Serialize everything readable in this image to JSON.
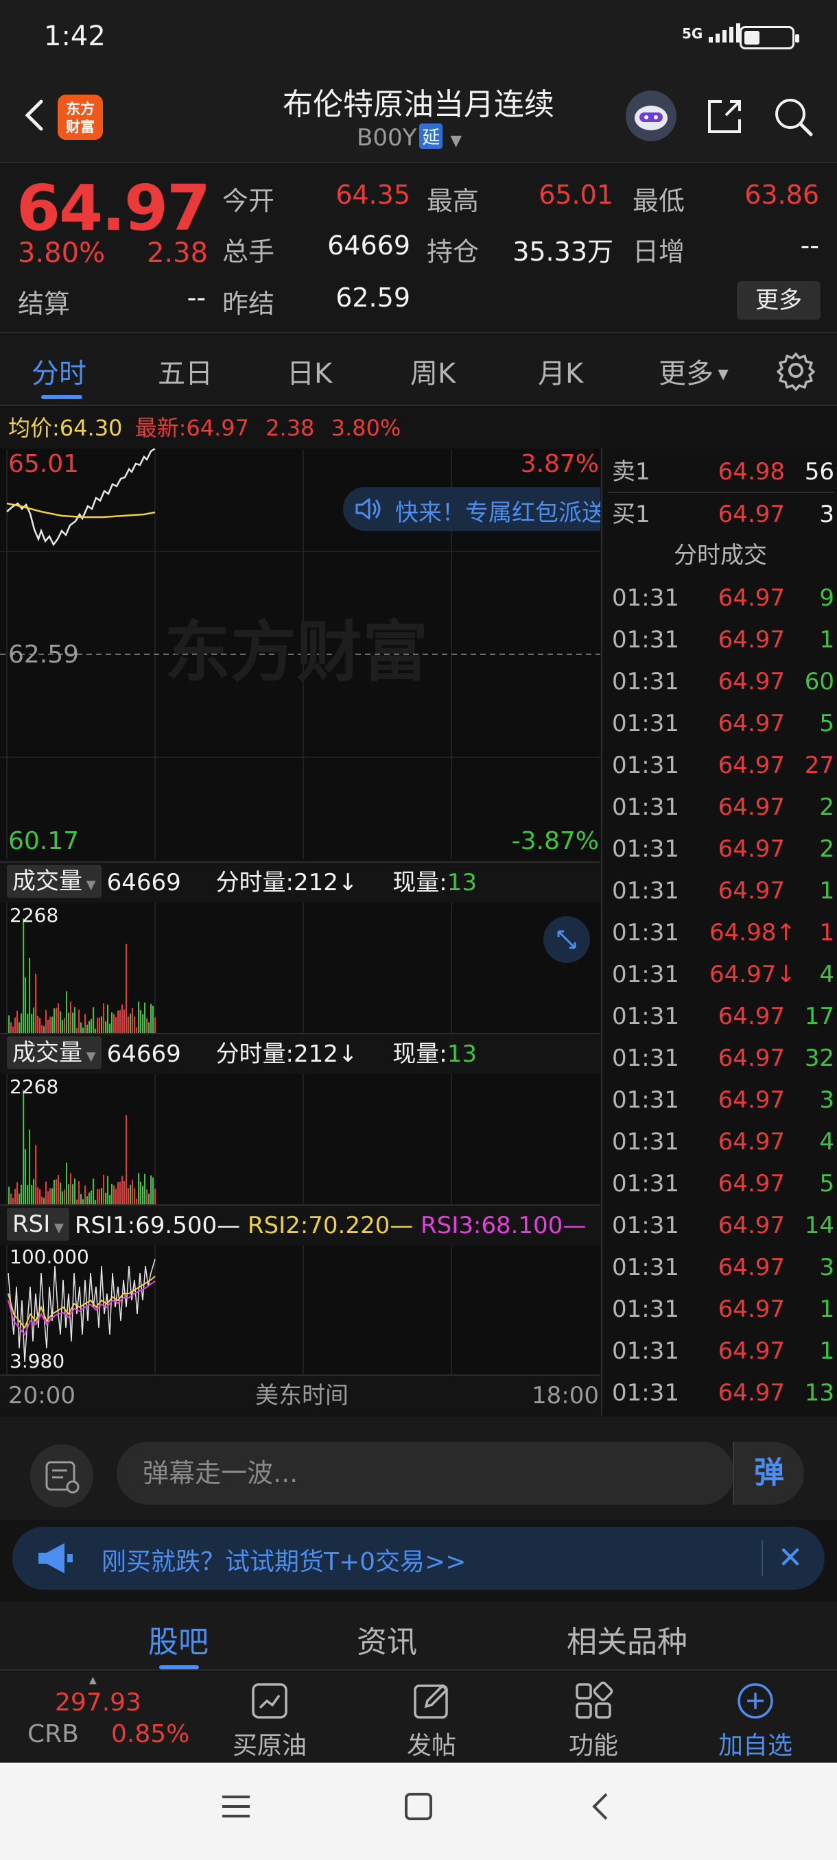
{
  "status": {
    "time": "1:42",
    "network": "5G"
  },
  "header": {
    "title": "布伦特原油当月连续",
    "code": "B00Y",
    "delay_badge": "延",
    "logo_line1": "东方",
    "logo_line2": "财富"
  },
  "quote": {
    "price": "64.97",
    "change_pct": "3.80%",
    "change": "2.38",
    "open_label": "今开",
    "open": "64.35",
    "high_label": "最高",
    "high": "65.01",
    "low_label": "最低",
    "low": "63.86",
    "volume_label": "总手",
    "volume": "64669",
    "oi_label": "持仓",
    "oi": "35.33万",
    "daily_inc_label": "日增",
    "daily_inc": "--",
    "settle_label": "结算",
    "settle": "--",
    "prev_settle_label": "昨结",
    "prev_settle": "62.59",
    "more_label": "更多"
  },
  "tabs": [
    "分时",
    "五日",
    "日K",
    "周K",
    "月K",
    "更多"
  ],
  "intraday": {
    "avg_label": "均价:",
    "avg": "64.30",
    "last_label": "最新:",
    "last": "64.97",
    "change": "2.38",
    "change_pct": "3.80%",
    "y_top": "65.01",
    "y_mid": "62.59",
    "y_bottom": "60.17",
    "pct_top": "3.87%",
    "pct_bottom": "-3.87%",
    "watermark": "东方财富",
    "banner": "快来！专属红包派送"
  },
  "volume_panel": {
    "label": "成交量",
    "total": "64669",
    "period_label": "分时量:",
    "period": "212",
    "now_label": "现量:",
    "now": "13",
    "axis_max": "2268"
  },
  "rsi_panel": {
    "label": "RSI",
    "rsi1": "RSI1:69.500",
    "rsi2": "RSI2:70.220",
    "rsi3": "RSI3:68.100",
    "axis_max": "100.000",
    "axis_min": "3.980"
  },
  "time_axis": {
    "start": "20:00",
    "tz": "美东时间",
    "end": "18:00"
  },
  "orderbook": {
    "sell_label": "卖1",
    "sell_price": "64.98",
    "sell_qty": "56",
    "buy_label": "买1",
    "buy_price": "64.97",
    "buy_qty": "3"
  },
  "ticks_title": "分时成交",
  "ticks": [
    {
      "t": "01:31",
      "p": "64.97",
      "v": "9",
      "c": "green"
    },
    {
      "t": "01:31",
      "p": "64.97",
      "v": "1",
      "c": "green"
    },
    {
      "t": "01:31",
      "p": "64.97",
      "v": "60",
      "c": "green"
    },
    {
      "t": "01:31",
      "p": "64.97",
      "v": "5",
      "c": "green"
    },
    {
      "t": "01:31",
      "p": "64.97",
      "v": "27",
      "c": "red"
    },
    {
      "t": "01:31",
      "p": "64.97",
      "v": "2",
      "c": "green"
    },
    {
      "t": "01:31",
      "p": "64.97",
      "v": "2",
      "c": "green"
    },
    {
      "t": "01:31",
      "p": "64.97",
      "v": "1",
      "c": "green"
    },
    {
      "t": "01:31",
      "p": "64.98↑",
      "v": "1",
      "c": "red"
    },
    {
      "t": "01:31",
      "p": "64.97↓",
      "v": "4",
      "c": "green"
    },
    {
      "t": "01:31",
      "p": "64.97",
      "v": "17",
      "c": "green"
    },
    {
      "t": "01:31",
      "p": "64.97",
      "v": "32",
      "c": "green"
    },
    {
      "t": "01:31",
      "p": "64.97",
      "v": "3",
      "c": "green"
    },
    {
      "t": "01:31",
      "p": "64.97",
      "v": "4",
      "c": "green"
    },
    {
      "t": "01:31",
      "p": "64.97",
      "v": "5",
      "c": "green"
    },
    {
      "t": "01:31",
      "p": "64.97",
      "v": "14",
      "c": "green"
    },
    {
      "t": "01:31",
      "p": "64.97",
      "v": "3",
      "c": "green"
    },
    {
      "t": "01:31",
      "p": "64.97",
      "v": "1",
      "c": "green"
    },
    {
      "t": "01:31",
      "p": "64.97",
      "v": "1",
      "c": "green"
    },
    {
      "t": "01:31",
      "p": "64.97",
      "v": "13",
      "c": "green"
    }
  ],
  "comment": {
    "placeholder": "弹幕走一波...",
    "button": "弹"
  },
  "promo": {
    "text": "刚买就跌？试试期货T+0交易>>"
  },
  "lower_tabs": [
    "股吧",
    "资讯",
    "相关品种"
  ],
  "toolbar": {
    "crb_value": "297.93",
    "crb_label": "CRB",
    "crb_pct": "0.85%",
    "items": [
      "买原油",
      "发帖",
      "功能",
      "加自选"
    ]
  },
  "colors": {
    "up": "#ea3a3a",
    "down": "#3ec43e",
    "accent": "#4c8ef0",
    "avg_line": "#f0d23c"
  }
}
